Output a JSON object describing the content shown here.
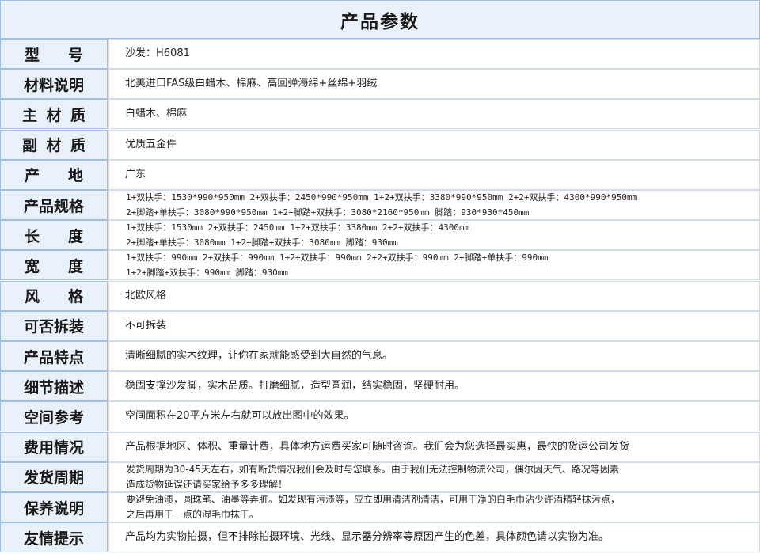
{
  "title": "产品参数",
  "rows": [
    {
      "label": "型号",
      "lines": [
        "沙发：H6081"
      ]
    },
    {
      "label": "材料说明",
      "lines": [
        "北美进口FAS级白蜡木、棉麻、高回弹海绵+丝绵+羽绒"
      ]
    },
    {
      "label": "主材质",
      "lines": [
        "白蜡木、棉麻"
      ]
    },
    {
      "label": "副材质",
      "lines": [
        "优质五金件"
      ]
    },
    {
      "label": "产地",
      "lines": [
        "广东"
      ]
    },
    {
      "label": "产品规格",
      "lines": [
        "1+双扶手：1530*990*950mm   2+双扶手：2450*990*950mm   1+2+双扶手：3380*990*950mm   2+2+双扶手：4300*990*950mm",
        "2+脚踏+单扶手：3080*990*950mm   1+2+脚踏+双扶手：3080*2160*950mm   脚踏：930*930*450mm"
      ]
    },
    {
      "label": "长度",
      "lines": [
        "1+双扶手：1530mm   2+双扶手：2450mm   1+2+双扶手：3380mm   2+2+双扶手：4300mm",
        "2+脚踏+单扶手：3080mm   1+2+脚踏+双扶手：3080mm   脚踏：930mm"
      ]
    },
    {
      "label": "宽度",
      "lines": [
        "1+双扶手：990mm   2+双扶手：990mm   1+2+双扶手：990mm   2+2+双扶手：990mm   2+脚踏+单扶手：990mm",
        "1+2+脚踏+双扶手：990mm   脚踏：930mm"
      ]
    },
    {
      "label": "风格",
      "lines": [
        "北欧风格"
      ]
    },
    {
      "label": "可否拆装",
      "lines": [
        "不可拆装"
      ]
    },
    {
      "label": "产品特点",
      "lines": [
        "清晰细腻的实木纹理，让你在家就能感受到大自然的气息。"
      ]
    },
    {
      "label": "细节描述",
      "lines": [
        "稳固支撑沙发脚，实木品质。打磨细腻，造型圆润，结实稳固，坚硬耐用。"
      ]
    },
    {
      "label": "空间参考",
      "lines": [
        "空间面积在20平方米左右就可以放出图中的效果。"
      ]
    },
    {
      "label": "费用情况",
      "lines": [
        "产品根据地区、体积、重量计费，具体地方运费买家可随时咨询。我们会为您选择最实惠，最快的货运公司发货"
      ]
    },
    {
      "label": "发货周期",
      "lines": [
        "发货周期为30-45天左右，如有断货情况我们会及时与您联系。由于我们无法控制物流公司，偶尔因天气、路况等因素",
        "造成货物延误还请买家给予多多理解！"
      ]
    },
    {
      "label": "保养说明",
      "lines": [
        "要避免油渍，圆珠笔、油墨等弄脏。如发现有污渍等，应立即用清洁剂清洁，可用干净的白毛巾沾少许酒精轻抹污点，",
        "之后再用干一点的湿毛巾抹干。"
      ]
    },
    {
      "label": "友情提示",
      "lines": [
        "产品均为实物拍摄，但不排除拍摄环境、光线、显示器分辨率等原因产生的色差，具体颜色请以实物为准。"
      ]
    }
  ]
}
